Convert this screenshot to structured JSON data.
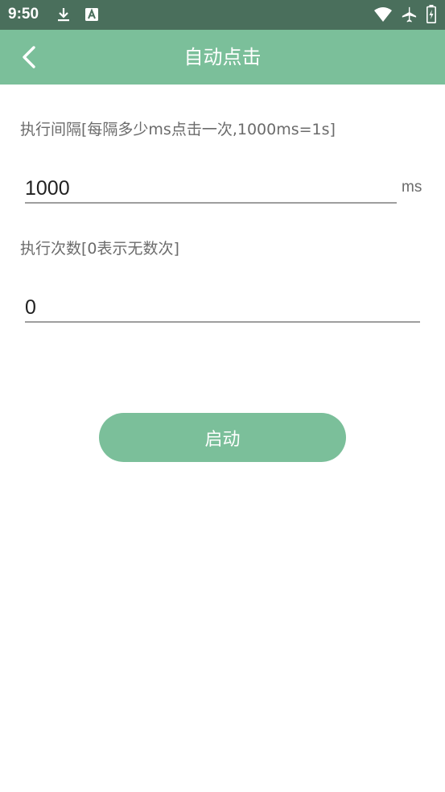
{
  "status_bar": {
    "time": "9:50",
    "icons": [
      "download-icon",
      "font-a-icon",
      "wifi-icon",
      "airplane-icon",
      "battery-charging-icon"
    ]
  },
  "app_bar": {
    "title": "自动点击",
    "back_icon": "chevron-left-icon",
    "background": "#7bbf9a"
  },
  "form": {
    "interval_label": "执行间隔[每隔多少ms点击一次,1000ms=1s]",
    "interval_value": "1000",
    "interval_unit": "ms",
    "count_label": "执行次数[0表示无数次]",
    "count_value": "0"
  },
  "actions": {
    "start_label": "启动"
  }
}
